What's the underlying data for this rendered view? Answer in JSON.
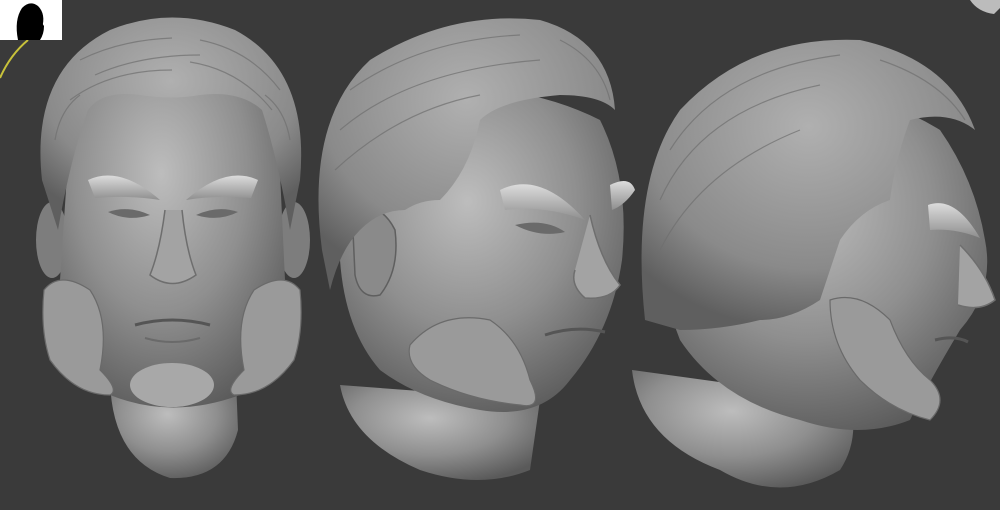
{
  "viewport": {
    "background": "#3a3a3a",
    "material_color": "#9c9c9c",
    "views": [
      "front",
      "three-quarter",
      "profile"
    ]
  },
  "navigator_thumbnail": {
    "icon": "head-silhouette-icon",
    "background": "#ffffff"
  },
  "gizmo": {
    "icon": "orientation-arc-icon",
    "color": "#c8c23a"
  }
}
